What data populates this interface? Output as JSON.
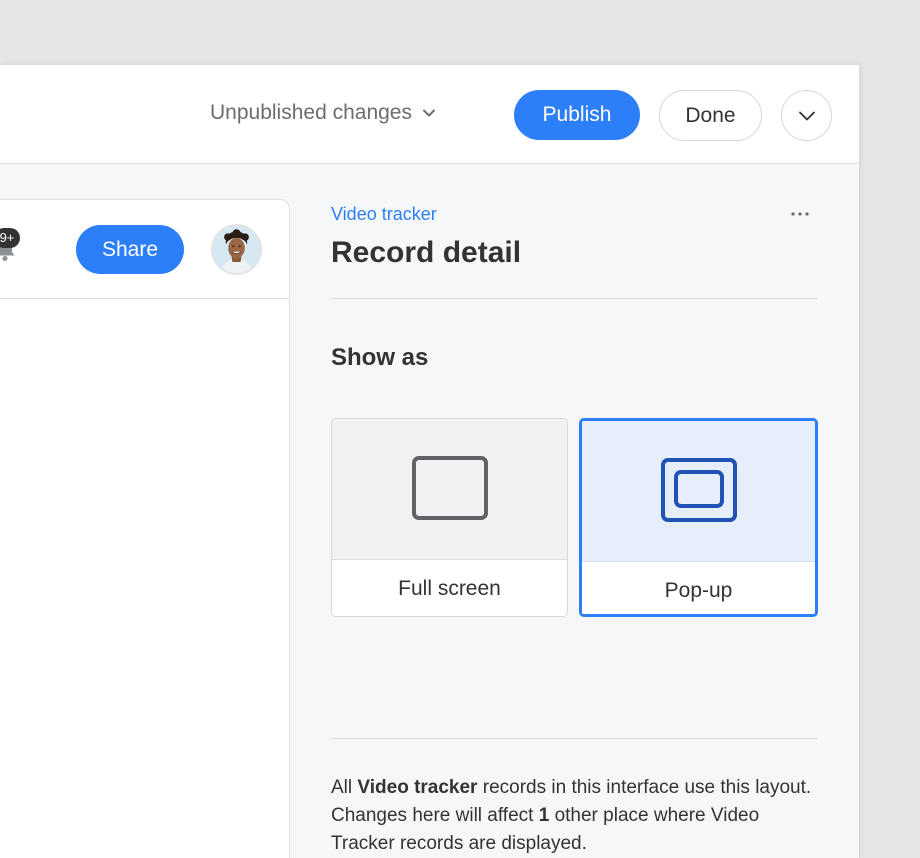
{
  "topbar": {
    "status_label": "Unpublished changes",
    "publish_label": "Publish",
    "done_label": "Done"
  },
  "preview": {
    "notification_count": "9+",
    "share_label": "Share"
  },
  "panel": {
    "breadcrumb": "Video tracker",
    "title": "Record detail",
    "show_as_heading": "Show as",
    "options": [
      {
        "label": "Full screen",
        "selected": false
      },
      {
        "label": "Pop-up",
        "selected": true
      }
    ],
    "note": {
      "part1": "All ",
      "table_name": "Video tracker",
      "part2": " records in this interface use this layout. Changes here will affect ",
      "count": "1",
      "part3": " other place where Video Tracker records are displayed."
    }
  },
  "colors": {
    "accent": "#2d7ff9",
    "selected_bg": "#e6eefc",
    "selected_icon": "#2152b5",
    "icon_gray": "#5f6164"
  },
  "icons": [
    "chevron-down-icon",
    "bell-icon",
    "more-icon",
    "fullscreen-icon",
    "popup-icon"
  ]
}
